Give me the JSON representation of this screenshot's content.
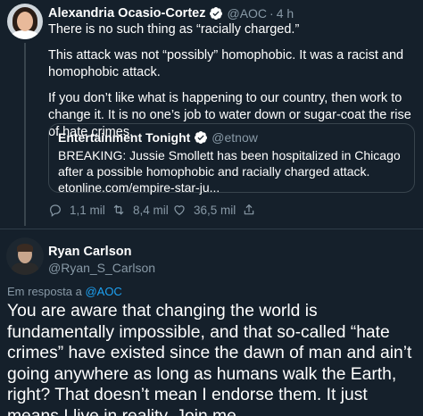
{
  "original_tweet": {
    "author_name": "Alexandria Ocasio-Cortez",
    "handle": "@AOC",
    "separator": "·",
    "time": "4 h",
    "paragraphs": [
      "There is no such thing as “racially charged.”",
      "This attack was not “possibly” homophobic. It was a racist and homophobic attack.",
      "If you don’t like what is happening to our country, then work to change it. It is no one’s job to water down or sugar-coat the rise of hate crimes."
    ],
    "quoted": {
      "author_name": "Entertainment Tonight",
      "handle": "@etnow",
      "text": "BREAKING: Jussie Smollett has been hospitalized in Chicago after a possible homophobic and racially charged attack. etonline.com/empire-star-ju..."
    },
    "actions": {
      "replies": "1,1 mil",
      "retweets": "8,4 mil",
      "likes": "36,5 mil"
    }
  },
  "reply_tweet": {
    "author_name": "Ryan Carlson",
    "handle": "@Ryan_S_Carlson",
    "reply_prefix": "Em resposta a",
    "reply_to": "@AOC",
    "text": "You are aware that changing the world is fundamentally impossible, and that so-called “hate crimes” have existed since the dawn of man and ain’t going anywhere as long as humans walk the Earth, right? That doesn’t mean I endorse them. It just means I live in reality. Join me."
  },
  "colors": {
    "background": "#15202b",
    "secondary_text": "#8899a6",
    "accent": "#1da1f2",
    "border": "#38444d"
  },
  "icons": [
    "verified-icon",
    "reply-icon",
    "retweet-icon",
    "like-icon",
    "share-icon"
  ]
}
